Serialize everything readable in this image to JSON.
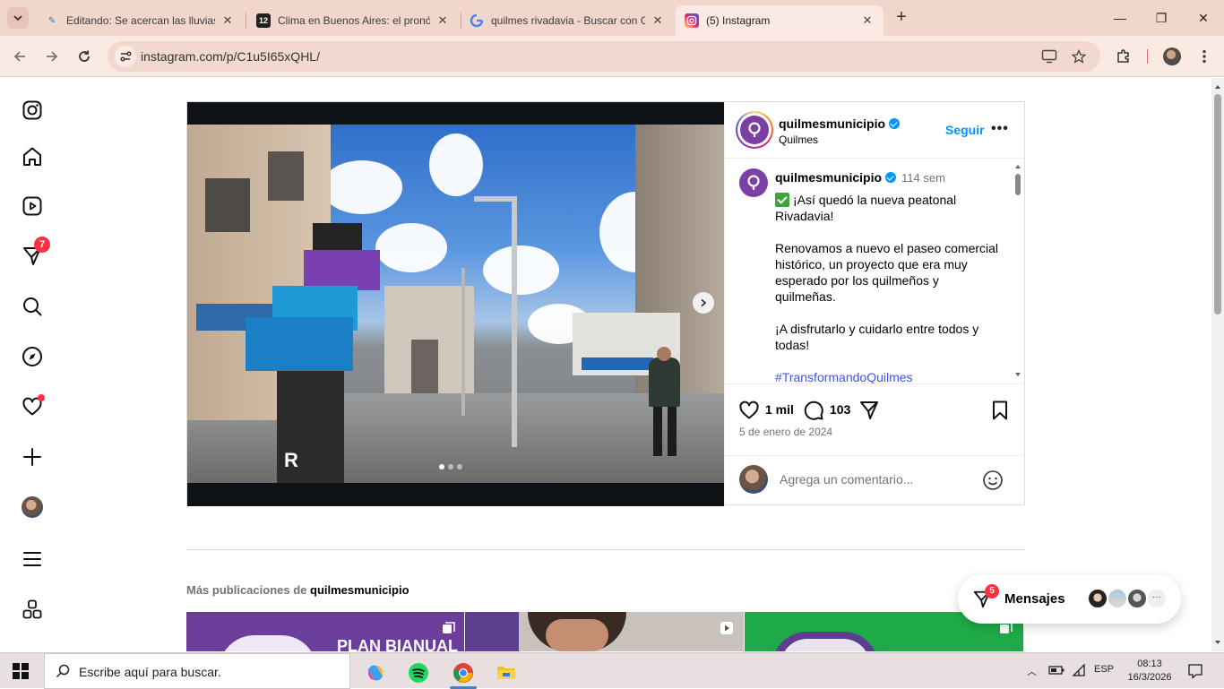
{
  "browser": {
    "tabs": [
      {
        "title": "Editando: Se acercan las lluvias",
        "icon": "edit-icon",
        "active": false
      },
      {
        "title": "Clima en Buenos Aires: el pronó",
        "icon": "newspaper-12-icon",
        "active": false
      },
      {
        "title": "quilmes rivadavia - Buscar con G",
        "icon": "google-icon",
        "active": false
      },
      {
        "title": "(5) Instagram",
        "icon": "instagram-icon",
        "active": true
      }
    ],
    "favicon_12_text": "12",
    "url": "instagram.com/p/C1u5I65xQHL/"
  },
  "nav": {
    "notifications_badge": "7",
    "items": [
      "instagram-logo-icon",
      "home-icon",
      "reels-icon",
      "messenger-icon",
      "search-icon",
      "explore-icon",
      "heart-icon",
      "create-icon",
      "profile-avatar",
      "menu-icon",
      "apps-icon"
    ]
  },
  "post": {
    "username": "quilmesmunicipio",
    "location": "Quilmes",
    "follow_label": "Seguir",
    "more_label": "•••",
    "time_ago": "114 sem",
    "caption_line1": "¡Así quedó la nueva peatonal Rivadavia!",
    "caption_p2": "Renovamos a nuevo el paseo comercial histórico, un proyecto que era muy esperado por los quilmeños y quilmeñas.",
    "caption_p3": "¡A disfrutarlo y cuidarlo entre todos y todas!",
    "hashtag": "#TransformandoQuilmes",
    "likes": "1 mil",
    "comments": "103",
    "date": "5 de enero de 2024",
    "comment_placeholder": "Agrega un comentario...",
    "photo_sign_text": "R",
    "carousel_dots": 3,
    "carousel_active": 1
  },
  "more_posts": {
    "prefix": "Más publicaciones de",
    "username": "quilmesmunicipio",
    "thumb1_text": "PLAN BIANUAL"
  },
  "messages": {
    "label": "Mensajes",
    "badge": "5"
  },
  "taskbar": {
    "search_placeholder": "Escribe aquí para buscar.",
    "lang": "ESP",
    "time": "08:13",
    "date": "16/3/2026"
  },
  "colors": {
    "accent": "#0095f6",
    "badge": "#ff3040",
    "hashtag": "#4150f7",
    "chrome_tabstrip": "#f1d6cc",
    "brand_purple": "#7b3fa6"
  }
}
